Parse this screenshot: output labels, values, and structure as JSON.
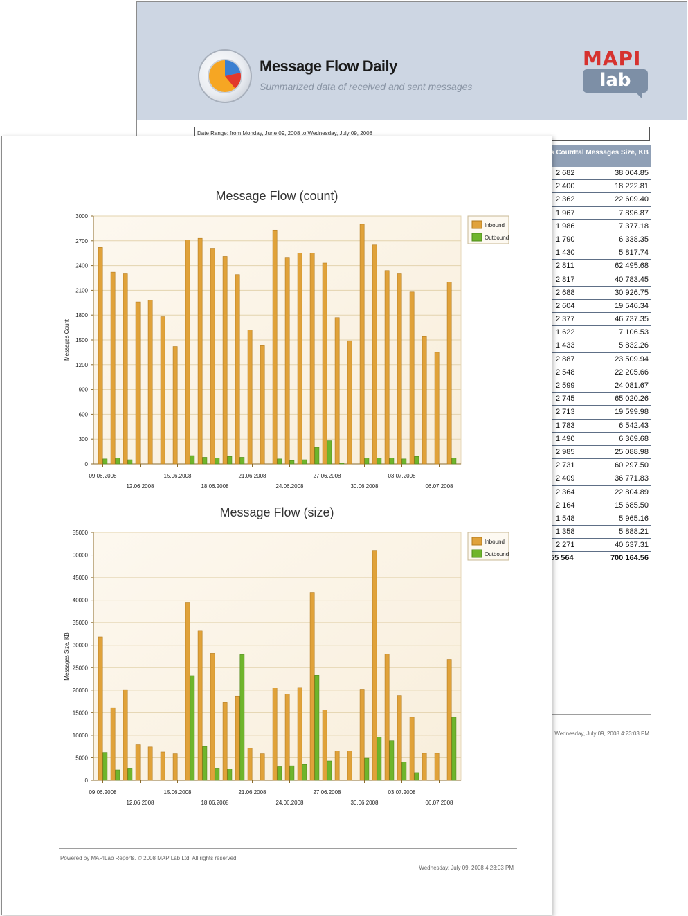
{
  "header": {
    "title": "Message Flow Daily",
    "subtitle": "Summarized data of received and sent messages",
    "brand_top": "MAPI",
    "brand_bottom": "lab"
  },
  "date_range": "Date Range: from Monday, June 09, 2008 to Wednesday, July 09, 2008",
  "table": {
    "columns": [
      "s Count",
      "Total Messages Size, KB"
    ],
    "rows": [
      [
        "2 682",
        "38 004.85"
      ],
      [
        "2 400",
        "18 222.81"
      ],
      [
        "2 362",
        "22 609.40"
      ],
      [
        "1 967",
        "7 896.87"
      ],
      [
        "1 986",
        "7 377.18"
      ],
      [
        "1 790",
        "6 338.35"
      ],
      [
        "1 430",
        "5 817.74"
      ],
      [
        "2 811",
        "62 495.68"
      ],
      [
        "2 817",
        "40 783.45"
      ],
      [
        "2 688",
        "30 926.75"
      ],
      [
        "2 604",
        "19 546.34"
      ],
      [
        "2 377",
        "46 737.35"
      ],
      [
        "1 622",
        "7 106.53"
      ],
      [
        "1 433",
        "5 832.26"
      ],
      [
        "2 887",
        "23 509.94"
      ],
      [
        "2 548",
        "22 205.66"
      ],
      [
        "2 599",
        "24 081.67"
      ],
      [
        "2 745",
        "65 020.26"
      ],
      [
        "2 713",
        "19 599.98"
      ],
      [
        "1 783",
        "6 542.43"
      ],
      [
        "1 490",
        "6 369.68"
      ],
      [
        "2 985",
        "25 088.98"
      ],
      [
        "2 731",
        "60 297.50"
      ],
      [
        "2 409",
        "36 771.83"
      ],
      [
        "2 364",
        "22 804.89"
      ],
      [
        "2 164",
        "15 685.50"
      ],
      [
        "1 548",
        "5 965.16"
      ],
      [
        "1 358",
        "5 888.21"
      ],
      [
        "2 271",
        "40 637.31"
      ]
    ],
    "total": [
      "55 564",
      "700 164.56"
    ]
  },
  "back_footer_date": "Wednesday, July 09, 2008 4:23:03 PM",
  "front_footer": {
    "powered": "Powered by MAPILab Reports. © 2008 MAPILab Ltd. All rights reserved.",
    "date": "Wednesday, July 09, 2008 4:23:03 PM"
  },
  "colors": {
    "inbound": "#e0a23a",
    "outbound": "#6fb52c",
    "plot_bg": "#f8eedb",
    "banner": "#cdd6e3"
  },
  "chart_data": [
    {
      "type": "bar",
      "title": "Message Flow (count)",
      "ylabel": "Messages Count",
      "ylim": [
        0,
        3000
      ],
      "yticks": [
        0,
        300,
        600,
        900,
        1200,
        1500,
        1800,
        2100,
        2400,
        2700,
        3000
      ],
      "xticks_top": [
        "09.06.2008",
        "15.06.2008",
        "21.06.2008",
        "27.06.2008",
        "03.07.2008"
      ],
      "xticks_bottom": [
        "12.06.2008",
        "18.06.2008",
        "24.06.2008",
        "30.06.2008",
        "06.07.2008"
      ],
      "legend": "top-right",
      "series": [
        {
          "name": "Inbound",
          "values": [
            2620,
            2320,
            2300,
            1960,
            1980,
            1780,
            1420,
            2710,
            2730,
            2610,
            2510,
            2290,
            1620,
            1430,
            2830,
            2500,
            2550,
            2550,
            2430,
            1770,
            1490,
            2900,
            2650,
            2340,
            2300,
            2080,
            1540,
            1350,
            2200
          ]
        },
        {
          "name": "Outbound",
          "values": [
            60,
            70,
            50,
            0,
            0,
            0,
            0,
            100,
            80,
            70,
            90,
            80,
            0,
            0,
            60,
            40,
            50,
            200,
            280,
            10,
            0,
            70,
            70,
            70,
            60,
            90,
            0,
            0,
            70
          ]
        }
      ]
    },
    {
      "type": "bar",
      "title": "Message Flow (size)",
      "ylabel": "Messages Size, KB",
      "ylim": [
        0,
        55000
      ],
      "yticks": [
        0,
        5000,
        10000,
        15000,
        20000,
        25000,
        30000,
        35000,
        40000,
        45000,
        50000,
        55000
      ],
      "xticks_top": [
        "09.06.2008",
        "15.06.2008",
        "21.06.2008",
        "27.06.2008",
        "03.07.2008"
      ],
      "xticks_bottom": [
        "12.06.2008",
        "18.06.2008",
        "24.06.2008",
        "30.06.2008",
        "06.07.2008"
      ],
      "legend": "top-right",
      "series": [
        {
          "name": "Inbound",
          "values": [
            31800,
            16100,
            20100,
            7900,
            7400,
            6300,
            5900,
            39400,
            33200,
            28200,
            17300,
            18700,
            7100,
            5900,
            20500,
            19100,
            20600,
            41700,
            15600,
            6500,
            6500,
            20200,
            50900,
            28000,
            18800,
            14000,
            6000,
            6000,
            26800
          ]
        },
        {
          "name": "Outbound",
          "values": [
            6200,
            2300,
            2700,
            0,
            0,
            0,
            0,
            23200,
            7500,
            2700,
            2500,
            27900,
            0,
            0,
            3000,
            3200,
            3500,
            23300,
            4300,
            0,
            0,
            4900,
            9600,
            8800,
            4100,
            1700,
            0,
            0,
            14000
          ]
        }
      ]
    }
  ]
}
